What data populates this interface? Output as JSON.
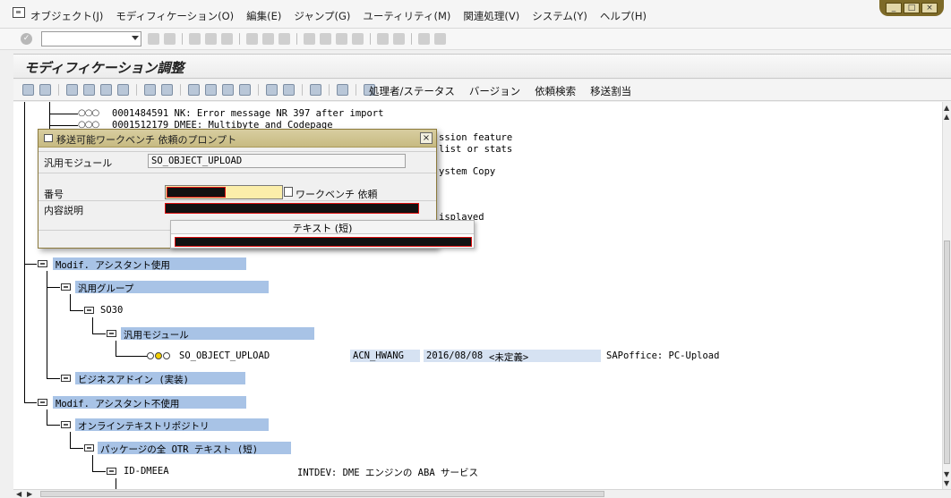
{
  "menubar": {
    "items": [
      "オブジェクト(J)",
      "モディフィケーション(O)",
      "編集(E)",
      "ジャンプ(G)",
      "ユーティリティ(M)",
      "関連処理(V)",
      "システム(Y)",
      "ヘルプ(H)"
    ]
  },
  "window_controls": [
    "_",
    "□",
    "×"
  ],
  "title": "モディフィケーション調整",
  "app_toolbar": {
    "buttons": [
      "処理者/ステータス",
      "バージョン",
      "依頼検索",
      "移送割当"
    ]
  },
  "tree": {
    "top_rows": [
      {
        "id": "0001484591",
        "text": "NK: Error message NR 397 after import"
      },
      {
        "id": "0001512179",
        "text": "DMEE: Multibyte and Codepage"
      }
    ],
    "partial_rows": [
      "ssion feature",
      "list or stats",
      "ystem Copy",
      "isplayed"
    ],
    "nodes": [
      {
        "label": "Modif. アシスタント使用"
      },
      {
        "label": "汎用グループ"
      },
      {
        "label": "SO30"
      },
      {
        "label": "汎用モジュール"
      },
      {
        "label": "SO_OBJECT_UPLOAD",
        "user": "ACN_HWANG",
        "date": "2016/08/08",
        "status": "<未定義>",
        "desc": "SAPoffice: PC-Upload"
      },
      {
        "label": "ビジネスアドイン (実装)"
      },
      {
        "label": "Modif. アシスタント不使用"
      },
      {
        "label": "オンラインテキストリポジトリ"
      },
      {
        "label": "パッケージの全 OTR テキスト (短)"
      },
      {
        "label": "ID-DMEEA",
        "desc": "INTDEV: DME エンジンの ABA サービス"
      }
    ]
  },
  "popup": {
    "title": "移送可能ワークベンチ 依頼のプロンプト",
    "close": "×",
    "fields": {
      "module_label": "汎用モジュール",
      "module_value": "SO_OBJECT_UPLOAD",
      "number_label": "番号",
      "number_suffix": "ワークベンチ 依頼",
      "desc_label": "内容説明"
    },
    "dropdown_header": "テキスト (短)"
  },
  "colors": {
    "selection": "#a8c3e6",
    "popup_title": "#c7ba82",
    "required_field": "#fbeeaa",
    "window_controls": "#7d6a28"
  }
}
